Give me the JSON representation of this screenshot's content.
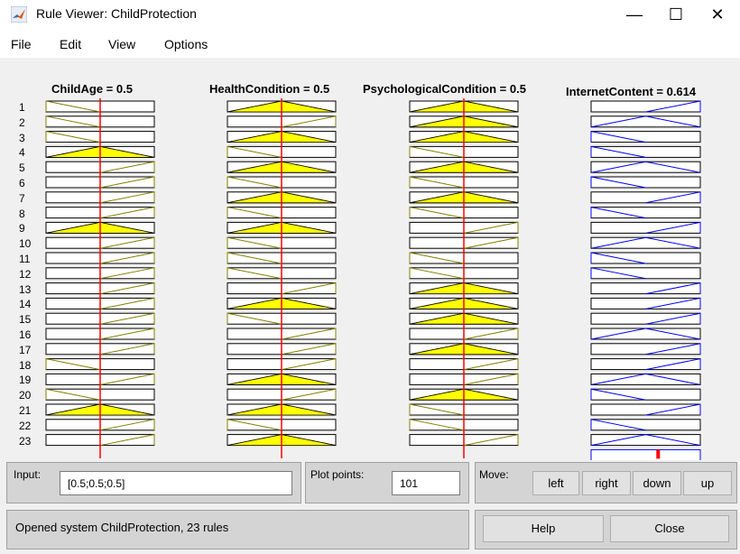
{
  "window": {
    "title": "Rule Viewer: ChildProtection",
    "minimize": "—",
    "maximize": "☐",
    "close": "✕",
    "icon": "matlab-icon"
  },
  "menu": [
    "File",
    "Edit",
    "View",
    "Options"
  ],
  "variables": [
    {
      "label": "ChildAge = 0.5",
      "input_value": 0.5
    },
    {
      "label": "HealthCondition = 0.5",
      "input_value": 0.5
    },
    {
      "label": "PsychologicalCondition = 0.5",
      "input_value": 0.5
    },
    {
      "label": "InternetContent = 0.614",
      "output_value": 0.614
    }
  ],
  "rule_numbers": [
    "1",
    "2",
    "3",
    "4",
    "5",
    "6",
    "7",
    "8",
    "9",
    "10",
    "11",
    "12",
    "13",
    "14",
    "15",
    "16",
    "17",
    "18",
    "19",
    "20",
    "21",
    "22",
    "23"
  ],
  "rules": {
    "child_age": [
      "low",
      "low",
      "low",
      "mid",
      "high",
      "high",
      "high",
      "high",
      "mid",
      "high",
      "high",
      "high",
      "high",
      "high",
      "high",
      "high",
      "high",
      "low",
      "high",
      "low",
      "mid",
      "high",
      "high"
    ],
    "health": [
      "mid",
      "high",
      "mid",
      "low",
      "mid",
      "low",
      "mid",
      "low",
      "mid",
      "low",
      "low",
      "low",
      "high",
      "mid",
      "low",
      "high",
      "high",
      "high",
      "mid",
      "high",
      "mid",
      "low",
      "mid"
    ],
    "psych": [
      "mid",
      "mid",
      "mid",
      "low",
      "mid",
      "low",
      "mid",
      "low",
      "high",
      "high",
      "low",
      "low",
      "mid",
      "mid",
      "mid",
      "high",
      "mid",
      "high",
      "high",
      "mid",
      "low",
      "low",
      "high"
    ],
    "internet": [
      "high",
      "mid",
      "low",
      "low",
      "mid",
      "low",
      "high",
      "low",
      "high",
      "mid",
      "low",
      "low",
      "high",
      "high",
      "high",
      "mid",
      "high",
      "high",
      "mid",
      "low",
      "high",
      "low",
      "mid"
    ]
  },
  "colors": {
    "input_fill": "#ffff00",
    "input_outline": "#808000",
    "output_line": "#0000ff",
    "indicator": "#ff0000"
  },
  "controls": {
    "input_label": "Input:",
    "input_value": "[0.5;0.5;0.5]",
    "plot_points_label": "Plot points:",
    "plot_points_value": "101",
    "move_label": "Move:",
    "left": "left",
    "right": "right",
    "down": "down",
    "up": "up",
    "status": "Opened system ChildProtection, 23 rules",
    "help": "Help",
    "close": "Close"
  }
}
